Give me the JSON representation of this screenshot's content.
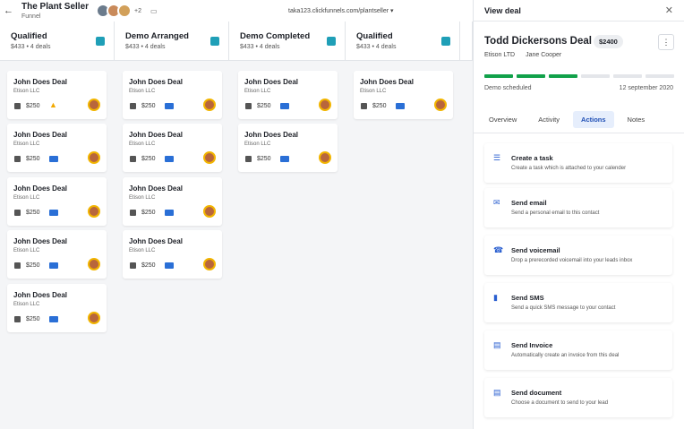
{
  "topbar": {
    "title": "The Plant Seller",
    "subtitle": "Funnel",
    "collaborators_more": "+2",
    "url": "taka123.clickfunnels.com/plantseller ▾"
  },
  "columns": [
    {
      "name": "Qualified",
      "meta": "$433 • 4 deals"
    },
    {
      "name": "Demo Arranged",
      "meta": "$433 • 4 deals"
    },
    {
      "name": "Demo Completed",
      "meta": "$433 • 4 deals"
    },
    {
      "name": "Qualified",
      "meta": "$433 • 4 deals"
    },
    {
      "name": "",
      "meta": ""
    }
  ],
  "cards": {
    "title": "John Does Deal",
    "company": "Etison LLC",
    "amount": "$250"
  },
  "drawer": {
    "header": "View deal",
    "close_icon": "✕",
    "deal_name": "Todd Dickersons Deal",
    "price": "$2400",
    "kebab": "⋮",
    "org": "Etison LTD",
    "person": "Jane Cooper",
    "progress_steps_done": 3,
    "progress_steps_total": 6,
    "stage": "Demo scheduled",
    "date": "12 september 2020",
    "tabs": [
      "Overview",
      "Activity",
      "Actions",
      "Notes"
    ],
    "active_tab": "Actions",
    "actions": [
      {
        "name": "Create a task",
        "desc": "Create a task which is attached to your calender",
        "icon": "☰"
      },
      {
        "name": "Send email",
        "desc": "Send a personal email to this contact",
        "icon": "✉"
      },
      {
        "name": "Send voicemail",
        "desc": "Drop a prerecorded voicemail into your leads inbox",
        "icon": "☎"
      },
      {
        "name": "Send SMS",
        "desc": "Send a quick SMS message to your contact",
        "icon": "▮"
      },
      {
        "name": "Send Invoice",
        "desc": "Automatically create an invoice from this deal",
        "icon": "▤"
      },
      {
        "name": "Send document",
        "desc": "Choose a document to send to your lead",
        "icon": "▤"
      }
    ]
  },
  "colors": {
    "accent": "#2a6fd6",
    "progress": "#11a14a",
    "warning": "#f2a900"
  }
}
